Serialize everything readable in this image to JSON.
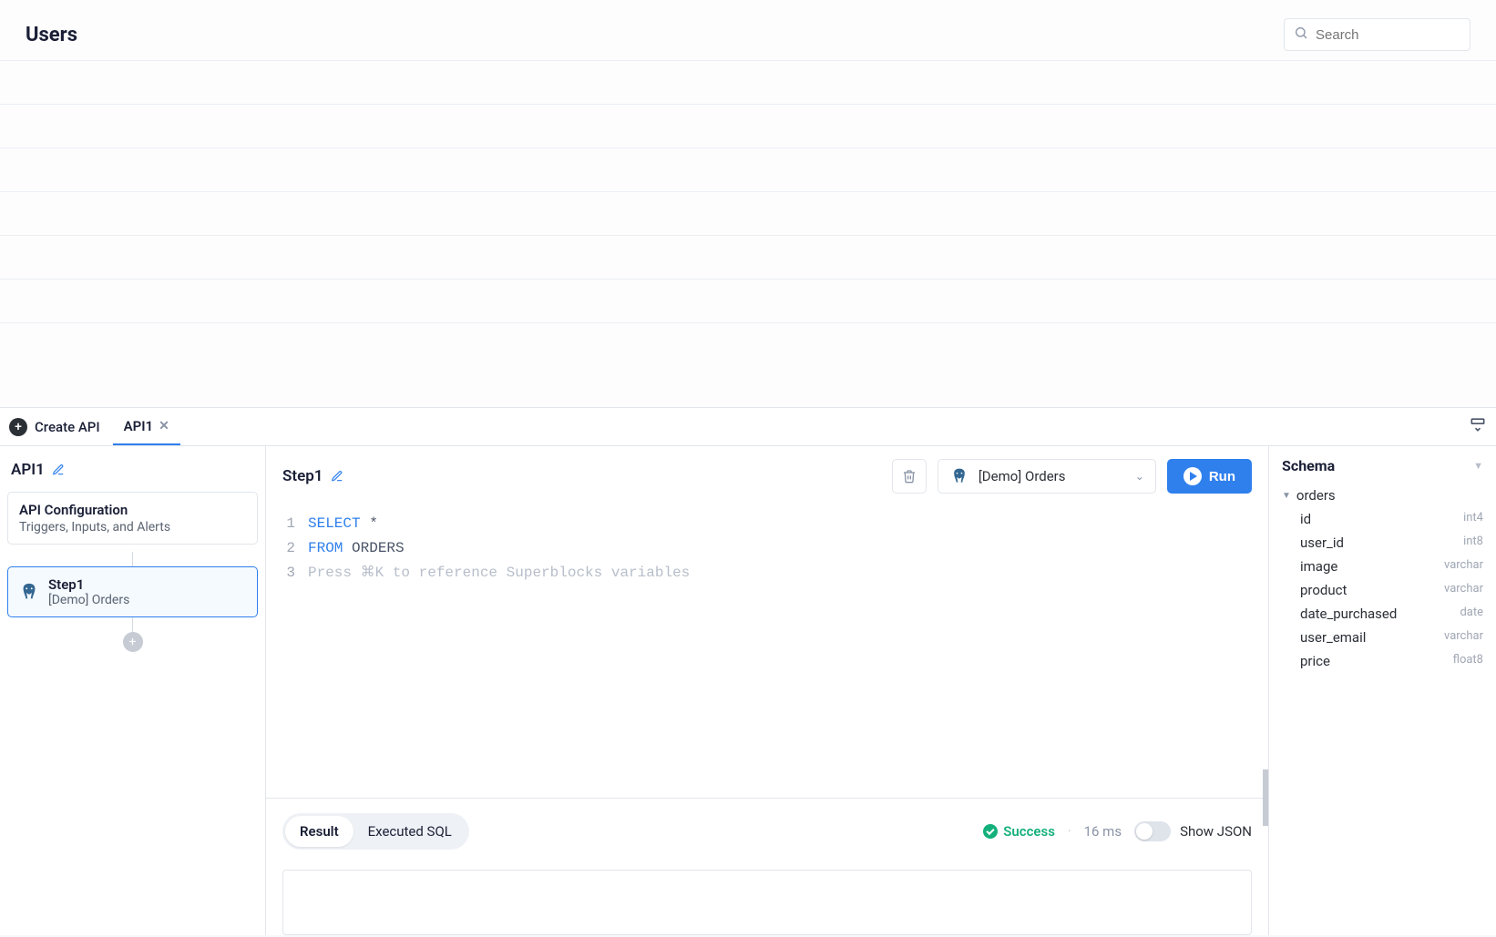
{
  "page": {
    "title": "Users"
  },
  "search": {
    "placeholder": "Search"
  },
  "tabs": {
    "create_api": "Create API",
    "api_tab": "API1"
  },
  "sidebar": {
    "api_name": "API1",
    "config": {
      "title": "API Configuration",
      "sub": "Triggers, Inputs, and Alerts"
    },
    "step": {
      "name": "Step1",
      "datasource": "[Demo] Orders"
    }
  },
  "editor": {
    "step_title": "Step1",
    "datasource": "[Demo] Orders",
    "run_label": "Run",
    "code": {
      "lines": [
        "1",
        "2",
        "3"
      ],
      "kw_select": "SELECT",
      "star": "*",
      "kw_from": "FROM",
      "tbl": "ORDERS",
      "placeholder": "Press ⌘K to reference Superblocks variables"
    }
  },
  "results": {
    "tabs": {
      "result": "Result",
      "executed": "Executed SQL"
    },
    "status": "Success",
    "time": "16 ms",
    "toggle_label": "Show JSON"
  },
  "schema": {
    "title": "Schema",
    "table": "orders",
    "columns": [
      {
        "name": "id",
        "type": "int4"
      },
      {
        "name": "user_id",
        "type": "int8"
      },
      {
        "name": "image",
        "type": "varchar"
      },
      {
        "name": "product",
        "type": "varchar"
      },
      {
        "name": "date_purchased",
        "type": "date"
      },
      {
        "name": "user_email",
        "type": "varchar"
      },
      {
        "name": "price",
        "type": "float8"
      }
    ]
  }
}
